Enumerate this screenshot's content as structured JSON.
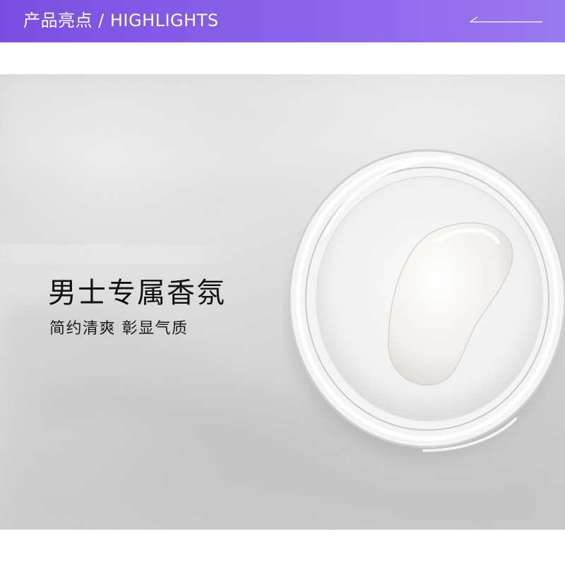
{
  "header": {
    "title": "产品亮点 / HIGHLIGHTS",
    "background_color": "#7a4fe0",
    "decoration": "thin-line-arrow-icon"
  },
  "hero": {
    "heading": "男士专属香氛",
    "subheading": "简约清爽 彰显气质",
    "image": "cream-jar-on-white-sand"
  }
}
